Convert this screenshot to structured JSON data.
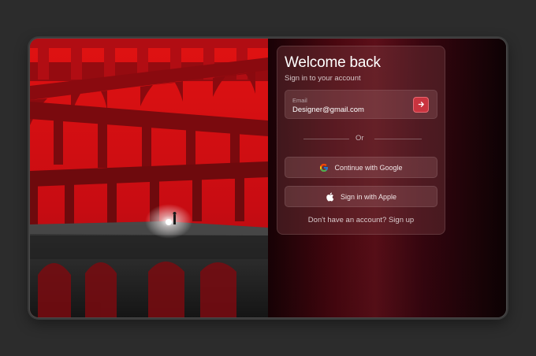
{
  "login": {
    "title": "Welcome back",
    "subtitle": "Sign in to your account",
    "email_label": "Email",
    "email_value": "Designer@gmail.com",
    "divider_text": "Or",
    "google_button": "Continue with Google",
    "apple_button": "Sign in with Apple",
    "signup_text": "Don't have an account? Sign up"
  },
  "icons": {
    "submit": "arrow-right-icon",
    "google": "google-logo-icon",
    "apple": "apple-logo-icon"
  },
  "colors": {
    "accent": "#c9343f",
    "artwork_red": "#d81418",
    "background": "#2c2c2c"
  }
}
